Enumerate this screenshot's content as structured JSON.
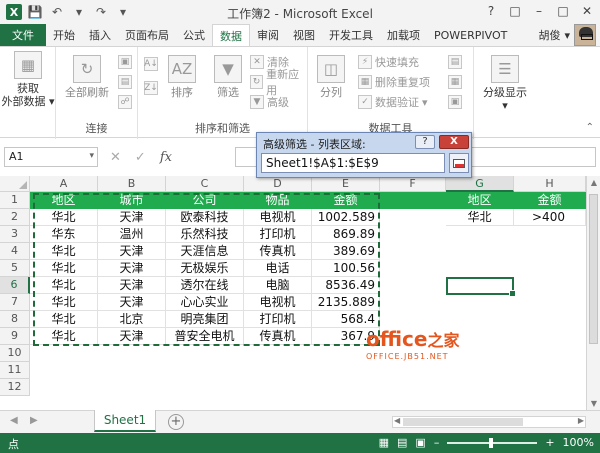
{
  "window": {
    "title": "工作簿2 - Microsoft Excel",
    "app_color": "#207245"
  },
  "tabs": {
    "file": "文件",
    "items": [
      "开始",
      "插入",
      "页面布局",
      "公式",
      "数据",
      "审阅",
      "视图",
      "开发工具",
      "加载项",
      "POWERPIVOT"
    ],
    "active": "数据"
  },
  "user": {
    "name": "胡俊"
  },
  "ribbon": {
    "groups": {
      "get_external": {
        "label": "获取\n外部数据"
      },
      "connections": {
        "refresh_all": "全部刷新",
        "label": "连接"
      },
      "sort_filter": {
        "sort": "排序",
        "filter": "筛选",
        "clear": "清除",
        "reapply": "重新应用",
        "advanced": "高级",
        "label": "排序和筛选"
      },
      "data_tools": {
        "split": "分列",
        "flash_fill": "快速填充",
        "remove_duplicates": "删除重复项",
        "validation": "数据验证",
        "label": "数据工具"
      },
      "outline": {
        "group_show": "分级显示"
      }
    }
  },
  "formula_bar": {
    "name_box": "A1",
    "fx": "fx",
    "value": ""
  },
  "dialog": {
    "title": "高级筛选 - 列表区域:",
    "help": "?",
    "close": "X",
    "value": "Sheet1!$A$1:$E$9"
  },
  "grid": {
    "columns": [
      "A",
      "B",
      "C",
      "D",
      "E",
      "F",
      "G",
      "H"
    ],
    "rows": [
      "1",
      "2",
      "3",
      "4",
      "5",
      "6",
      "7",
      "8",
      "9",
      "10",
      "11",
      "12"
    ],
    "header_color": "#1fab4e",
    "table": {
      "headers": [
        "地区",
        "城市",
        "公司",
        "物品",
        "金额"
      ],
      "data": [
        [
          "华北",
          "天津",
          "欧泰科技",
          "电视机",
          "1002.589"
        ],
        [
          "华东",
          "温州",
          "乐然科技",
          "打印机",
          "869.89"
        ],
        [
          "华北",
          "天津",
          "天涯信息",
          "传真机",
          "389.69"
        ],
        [
          "华北",
          "天津",
          "无极娱乐",
          "电话",
          "100.56"
        ],
        [
          "华北",
          "天津",
          "透尔在线",
          "电脑",
          "8536.49"
        ],
        [
          "华北",
          "天津",
          "心心实业",
          "电视机",
          "2135.889"
        ],
        [
          "华北",
          "北京",
          "明亮集团",
          "打印机",
          "568.4"
        ],
        [
          "华北",
          "天津",
          "普安全电机",
          "传真机",
          "367.9"
        ]
      ]
    },
    "criteria": {
      "headers": [
        "地区",
        "金额"
      ],
      "values": [
        "华北",
        ">400"
      ]
    }
  },
  "watermark": {
    "main": "office",
    "cn": "之家",
    "sub": "OFFICE.JB51.NET"
  },
  "sheets": {
    "tabs": [
      "Sheet1"
    ],
    "add": "+"
  },
  "status": {
    "left": "点",
    "zoom": "100%"
  }
}
